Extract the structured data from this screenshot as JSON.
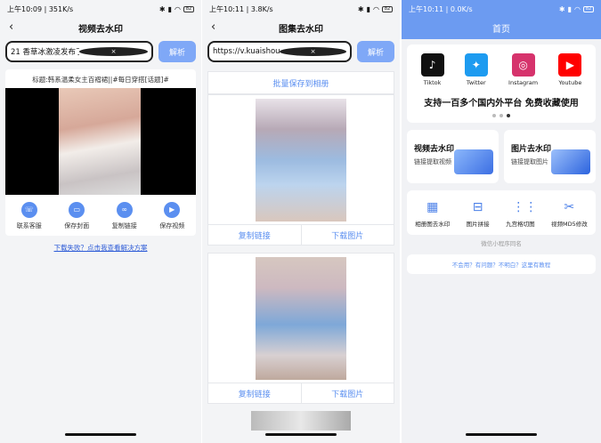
{
  "phone1": {
    "status": {
      "time": "上午10:09",
      "speed": "351K/s",
      "battery": "82"
    },
    "title": "视频去水印",
    "url_value": "21 香草冰激凌发布了一篇小红书笔记",
    "parse_label": "解析",
    "video_title": "标题:韩系温柔女主百褶裙||#每日穿搭[话题]#",
    "actions": [
      {
        "label": "联系客服",
        "icon": "headset-icon"
      },
      {
        "label": "保存封面",
        "icon": "image-icon"
      },
      {
        "label": "复制链接",
        "icon": "link-icon"
      },
      {
        "label": "保存视频",
        "icon": "video-icon"
      }
    ],
    "help_link": "下载失败？点击我查看解决方案"
  },
  "phone2": {
    "status": {
      "time": "上午10:11",
      "speed": "3.8K/s",
      "battery": "82"
    },
    "title": "图集去水印",
    "url_value": "https://v.kuaishou.com/llbpdz",
    "parse_label": "解析",
    "bulk_save": "批量保存到相册",
    "copy_link": "复制链接",
    "download_image": "下载图片"
  },
  "phone3": {
    "status": {
      "time": "上午10:11",
      "speed": "0.0K/s",
      "battery": "82"
    },
    "title": "首页",
    "platforms": [
      {
        "name": "Tiktok",
        "color": "#111111",
        "glyph": "♪"
      },
      {
        "name": "Twitter",
        "color": "#1d9bf0",
        "glyph": "✦"
      },
      {
        "name": "Instagram",
        "color": "#d6336c",
        "glyph": "◎"
      },
      {
        "name": "Youtube",
        "color": "#ff0000",
        "glyph": "▶"
      }
    ],
    "banner": "支持一百多个国内外平台 免费收藏使用",
    "tools": [
      {
        "title": "视频去水印",
        "subtitle": "链接提取视频"
      },
      {
        "title": "图片去水印",
        "subtitle": "链接提取图片"
      }
    ],
    "grid": [
      {
        "label": "相册图去水印",
        "glyph": "▦"
      },
      {
        "label": "图片拼接",
        "glyph": "⊟"
      },
      {
        "label": "九宫格切图",
        "glyph": "⋮⋮"
      },
      {
        "label": "视频MD5修改",
        "glyph": "✂"
      }
    ],
    "note": "微信小程序同名",
    "faq": "不会用？有问题？不明白？这里有教程"
  }
}
